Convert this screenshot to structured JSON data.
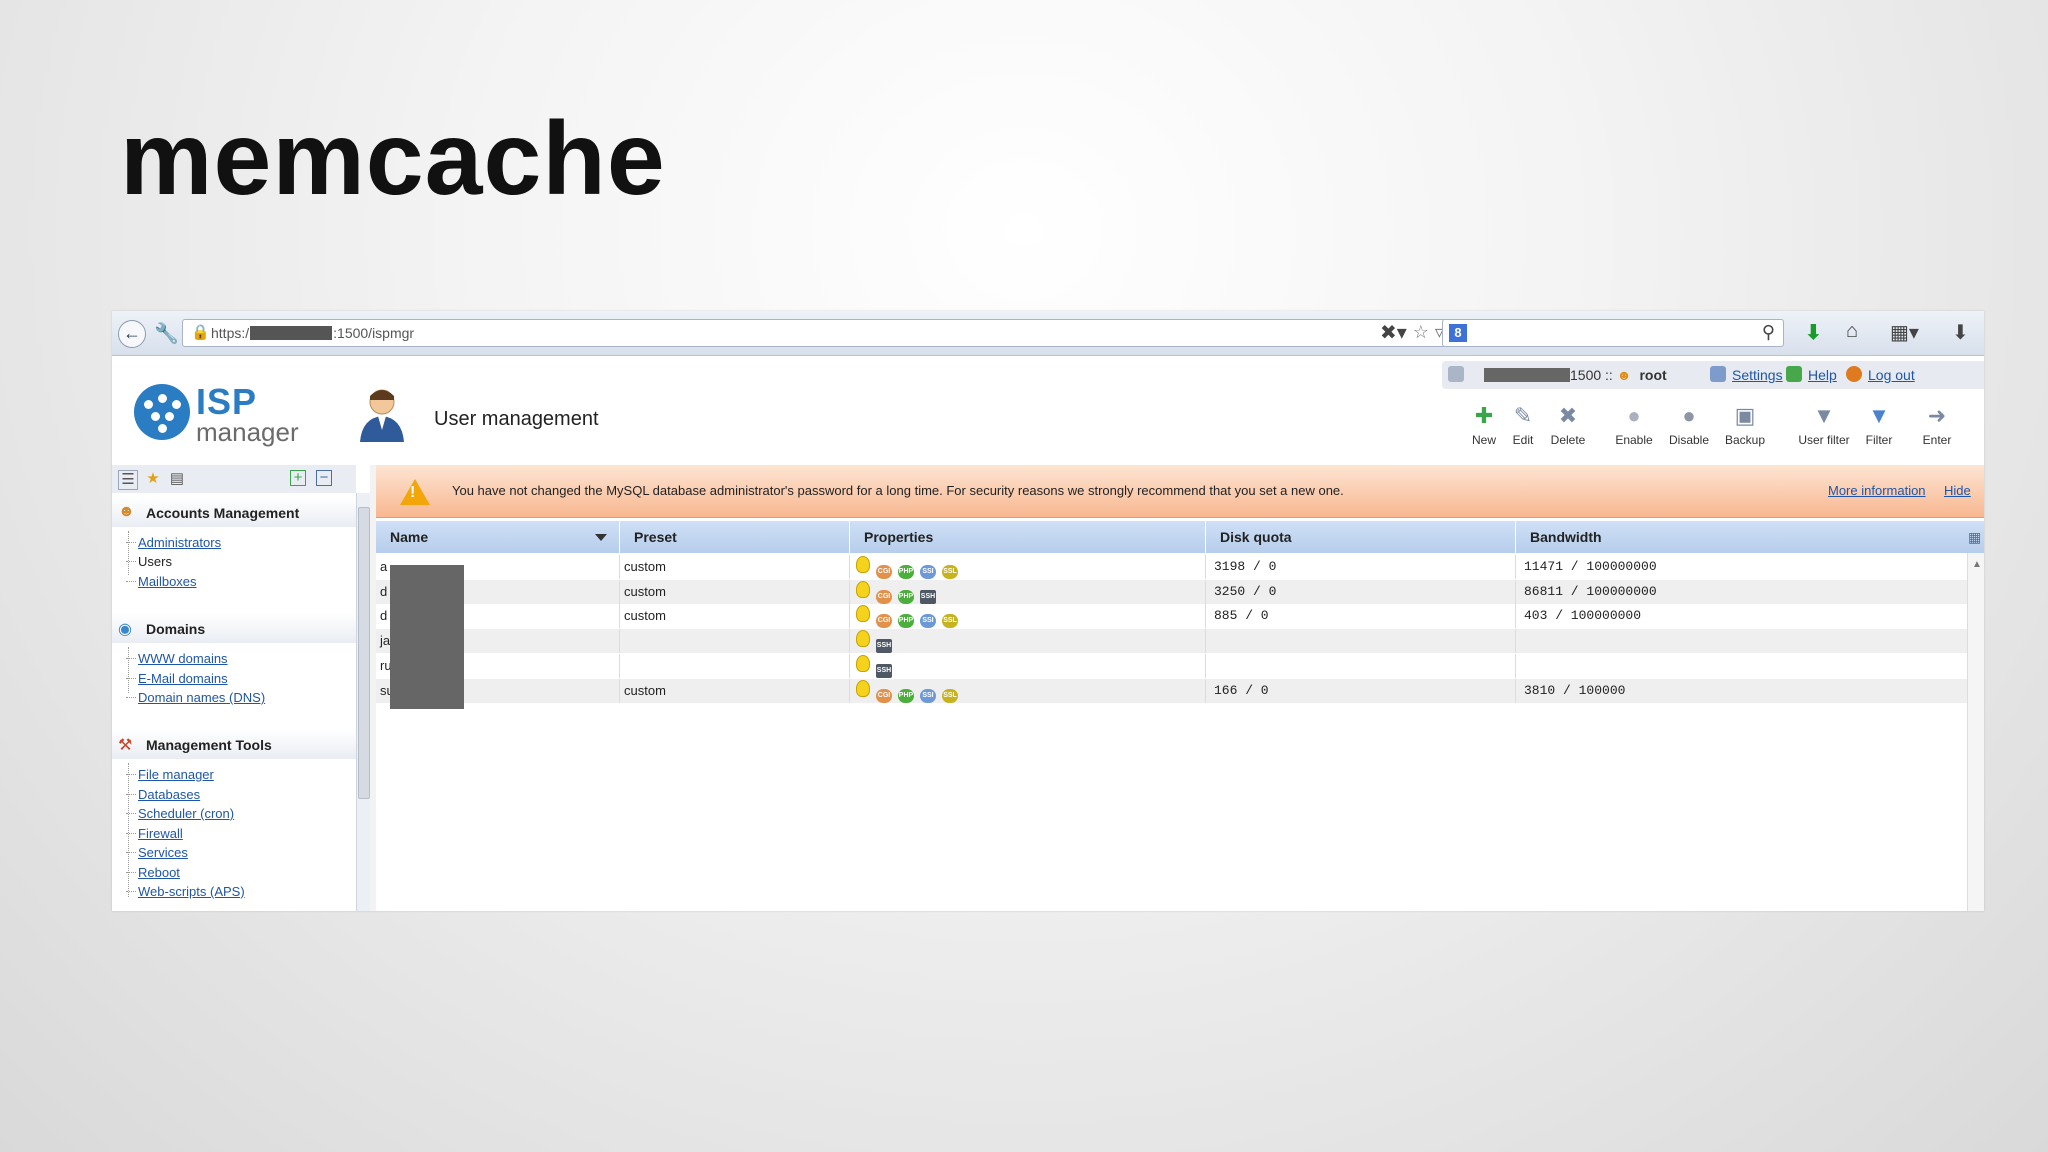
{
  "slide": {
    "title": "memcache"
  },
  "browser": {
    "url_prefix": "https:/",
    "url_suffix": ":1500/ispmgr"
  },
  "app": {
    "logo_isp": "ISP",
    "logo_manager": "manager",
    "page_title": "User management",
    "server_port": "1500 ::",
    "user": "root",
    "links": {
      "settings": "Settings",
      "help": "Help",
      "logout": "Log out"
    }
  },
  "toolbar": {
    "new": "New",
    "edit": "Edit",
    "delete": "Delete",
    "enable": "Enable",
    "disable": "Disable",
    "backup": "Backup",
    "user_filter": "User filter",
    "filter": "Filter",
    "enter": "Enter"
  },
  "sidebar": {
    "groups": [
      {
        "title": "Accounts Management",
        "items": [
          "Administrators",
          "Users",
          "Mailboxes"
        ]
      },
      {
        "title": "Domains",
        "items": [
          "WWW domains",
          "E-Mail domains",
          "Domain names (DNS)"
        ]
      },
      {
        "title": "Management Tools",
        "items": [
          "File manager",
          "Databases",
          "Scheduler (cron)",
          "Firewall",
          "Services",
          "Reboot",
          "Web-scripts (APS)"
        ]
      }
    ]
  },
  "warning": {
    "text": "You have not changed the MySQL database administrator's password for a long time. For security reasons we strongly recommend that you set a new one.",
    "more": "More information",
    "hide": "Hide"
  },
  "table": {
    "headers": [
      "Name",
      "Preset",
      "Properties",
      "Disk quota",
      "Bandwidth"
    ],
    "rows": [
      {
        "name": "a",
        "preset": "custom",
        "disk": "3198 / 0",
        "bandwidth": "11471 / 100000000",
        "props": [
          "bulb",
          "cgi",
          "php",
          "ssi",
          "ssl"
        ]
      },
      {
        "name": "d",
        "preset": "custom",
        "disk": "3250 / 0",
        "bandwidth": "86811 / 100000000",
        "props": [
          "bulb",
          "cgi",
          "php",
          "ssh"
        ]
      },
      {
        "name": "d",
        "preset": "custom",
        "disk": "885 / 0",
        "bandwidth": "403 / 100000000",
        "props": [
          "bulb",
          "cgi",
          "php",
          "ssi",
          "ssl"
        ]
      },
      {
        "name": "ja",
        "preset": "",
        "disk": "",
        "bandwidth": "",
        "props": [
          "bulb",
          "ssh"
        ]
      },
      {
        "name": "ru",
        "preset": "",
        "disk": "",
        "bandwidth": "",
        "props": [
          "bulb",
          "ssh"
        ]
      },
      {
        "name": "su",
        "preset": "custom",
        "disk": "166 / 0",
        "bandwidth": "3810 / 100000",
        "props": [
          "bulb",
          "cgi",
          "php",
          "ssi",
          "ssl"
        ]
      }
    ]
  },
  "icon_colors": {
    "cgi": "#e3904a",
    "php": "#4cae3c",
    "ssi": "#6d9ad6",
    "ssl": "#c7b21f",
    "ssh": "#4f5966"
  },
  "icon_text": {
    "cgi": "CGI",
    "php": "PHP",
    "ssi": "SSI",
    "ssl": "SSL",
    "ssh": "SSH"
  }
}
